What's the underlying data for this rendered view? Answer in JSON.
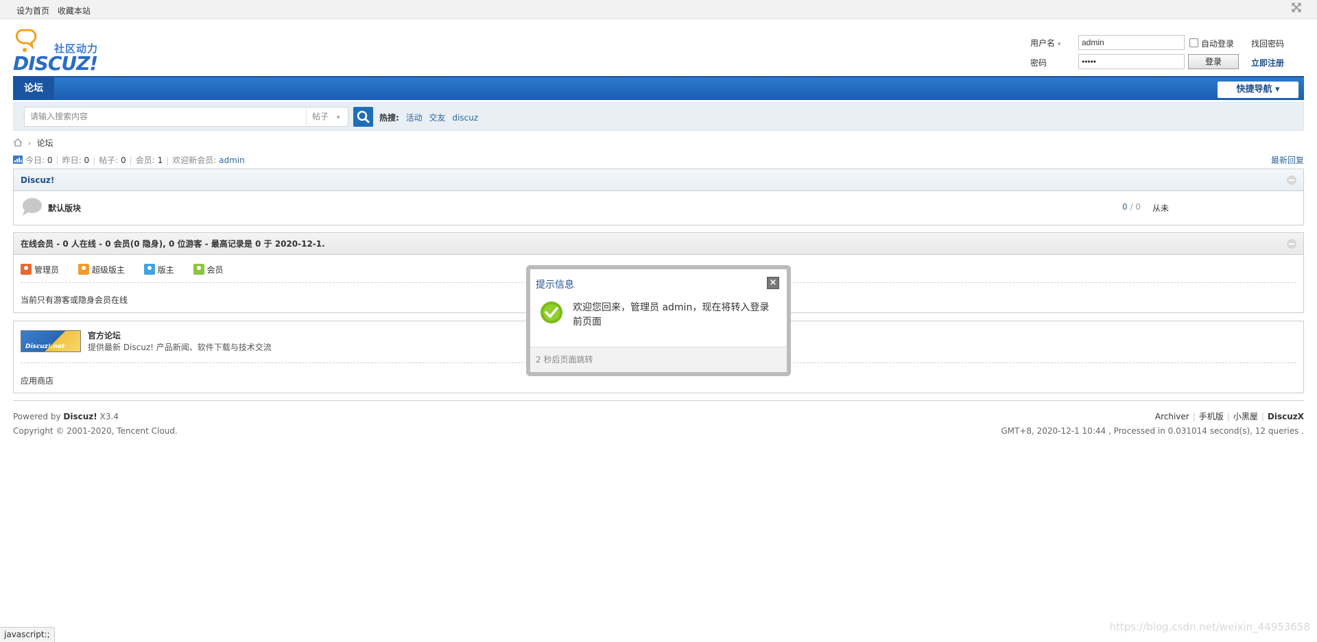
{
  "topbar": {
    "set_home": "设为首页",
    "bookmark": "收藏本站"
  },
  "logo": {
    "brand": "DISCUZ!",
    "tagline": "社区动力"
  },
  "login": {
    "username_label": "用户名",
    "username_value": "admin",
    "password_label": "密码",
    "password_value": "•••••",
    "auto_login_label": "自动登录",
    "auto_login_checked": false,
    "login_button": "登录",
    "find_password": "找回密码",
    "register": "立即注册"
  },
  "nav": {
    "forum": "论坛",
    "quick_nav": "快捷导航 ▾"
  },
  "search": {
    "placeholder": "请输入搜索内容",
    "type": "帖子",
    "hot_label": "热搜:",
    "hot_terms": [
      "活动",
      "交友",
      "discuz"
    ]
  },
  "breadcrumb": {
    "current": "论坛"
  },
  "stats": {
    "today_label": "今日:",
    "today": "0",
    "yesterday_label": "昨日:",
    "yesterday": "0",
    "posts_label": "帖子:",
    "posts": "0",
    "members_label": "会员:",
    "members": "1",
    "welcome_label": "欢迎新会员:",
    "new_member": "admin",
    "latest_reply": "最新回复"
  },
  "category": {
    "title": "Discuz!",
    "forum_name": "默认版块",
    "threads": "0",
    "posts": "0",
    "last_post": "从未"
  },
  "online": {
    "title": "在线会员",
    "summary": " - 0 人在线 - 0 会员(0 隐身), 0 位游客 - 最高记录是 0 于 2020-12-1.",
    "legend": [
      {
        "label": "管理员",
        "color": "#e8692f"
      },
      {
        "label": "超级版主",
        "color": "#f29a2f"
      },
      {
        "label": "版主",
        "color": "#3fa4dc"
      },
      {
        "label": "会员",
        "color": "#8cc63f"
      }
    ],
    "empty_text": "当前只有游客或隐身会员在线"
  },
  "links": {
    "logo_text": "Discuz!.net",
    "title": "官方论坛",
    "desc": "提供最新 Discuz! 产品新闻、软件下载与技术交流",
    "app_store": "应用商店"
  },
  "footer": {
    "powered_prefix": "Powered by ",
    "powered_name": "Discuz!",
    "version": " X3.4",
    "copyright": "Copyright © 2001-2020, Tencent Cloud.",
    "links": [
      "Archiver",
      "手机版",
      "小黑屋",
      "DiscuzX"
    ],
    "processed": "GMT+8, 2020-12-1 10:44 , Processed in 0.031014 second(s), 12 queries ."
  },
  "modal": {
    "title": "提示信息",
    "message": "欢迎您回来，管理员 admin，现在将转入登录前页面",
    "footer": "2 秒后页面跳转"
  },
  "statusbar": "javascript:;",
  "watermark": "https://blog.csdn.net/weixin_44953658"
}
